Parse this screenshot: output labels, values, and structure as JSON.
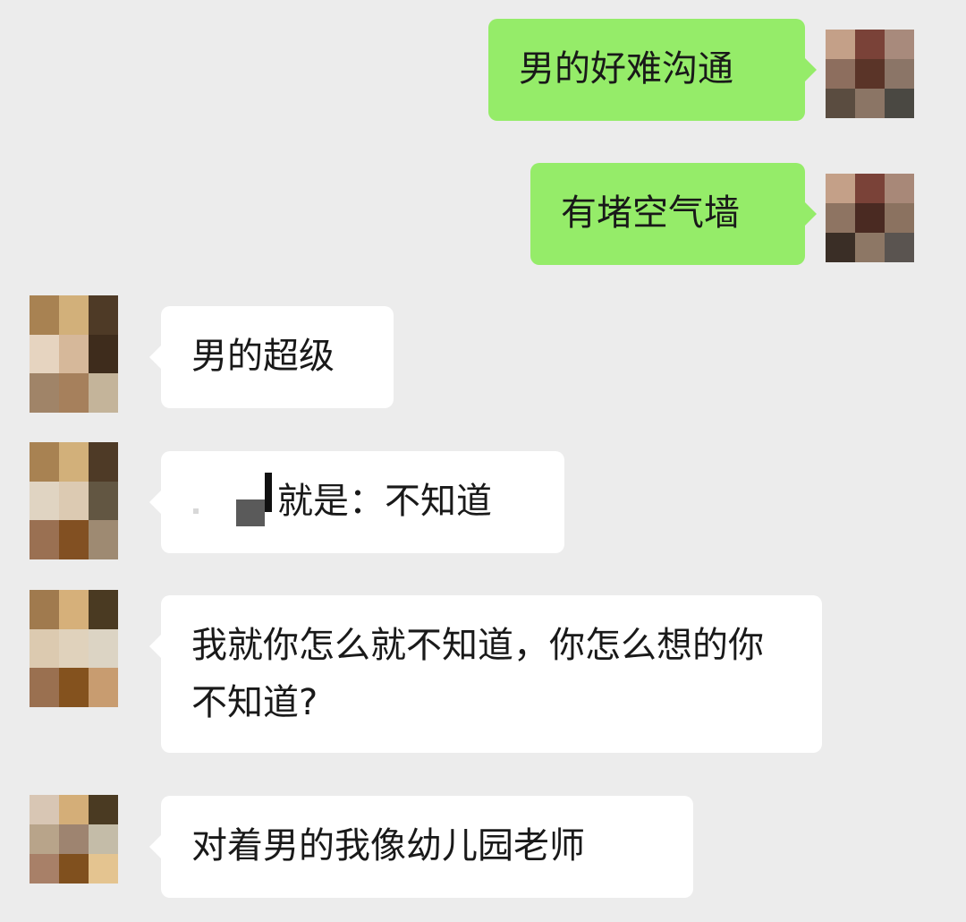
{
  "messages": [
    {
      "direction": "out",
      "text": "男的好难沟通"
    },
    {
      "direction": "out",
      "text": "有堵空气墙"
    },
    {
      "direction": "in",
      "text": "男的超级"
    },
    {
      "direction": "in",
      "text": "就是：不知道",
      "redacted_prefix": true
    },
    {
      "direction": "in",
      "text": "我就你怎么就不知道，你怎么想的你不知道?"
    },
    {
      "direction": "in",
      "text": "对着男的我像幼儿园老师"
    }
  ],
  "colors": {
    "background": "#ececec",
    "outgoing_bubble": "#95ec69",
    "incoming_bubble": "#ffffff",
    "text": "#191919"
  },
  "avatars": {
    "self": {
      "icon": "pixelated-avatar-icon",
      "tiles": [
        [
          "#c4a088",
          "#7a4238",
          "#a88870",
          "#a6877b",
          "#8d6e5e",
          "#5a3428",
          "#8b7567",
          "#8c7e6b",
          "#5a4c40",
          "#8b7565",
          "#7a6558",
          "#4a4842"
        ],
        [
          "#c4a088",
          "#7a4238",
          "#a88878",
          "#8e7462",
          "#4a2a22",
          "#8b7260",
          "#3a2e26",
          "#8d7765",
          "#5a5450"
        ]
      ]
    },
    "other": {
      "icon": "pixelated-avatar-icon",
      "tiles": [
        [
          "#a88252",
          "#d2b07a",
          "#4e3a26",
          "#e6d4c0",
          "#d6b89a",
          "#3e2c1c",
          "#a08468",
          "#a6805c",
          "#c4b49a",
          "#b08c74",
          "#ae8456",
          "#e4c088"
        ],
        [
          "#a88252",
          "#d2b07a",
          "#4e3a26",
          "#e0d4c2",
          "#dccab2",
          "#625642",
          "#9a7052",
          "#825022",
          "#9e8a72",
          "#b08c74",
          "#c69c6c",
          "#e6c48c"
        ],
        [
          "#a07a4e",
          "#d6b07a",
          "#4a3a22",
          "#dccab0",
          "#e0d2bc",
          "#dcd4c4",
          "#9a7050",
          "#84521e",
          "#c89c70",
          "#b89c80",
          "#dcbc84",
          "#e6c48c"
        ],
        [
          "#d8c6b4",
          "#d4ae78",
          "#4a3a22",
          "#b8a48a",
          "#9e8470",
          "#c4bca8",
          "#a88068",
          "#80501e",
          "#e4c490"
        ]
      ]
    }
  }
}
